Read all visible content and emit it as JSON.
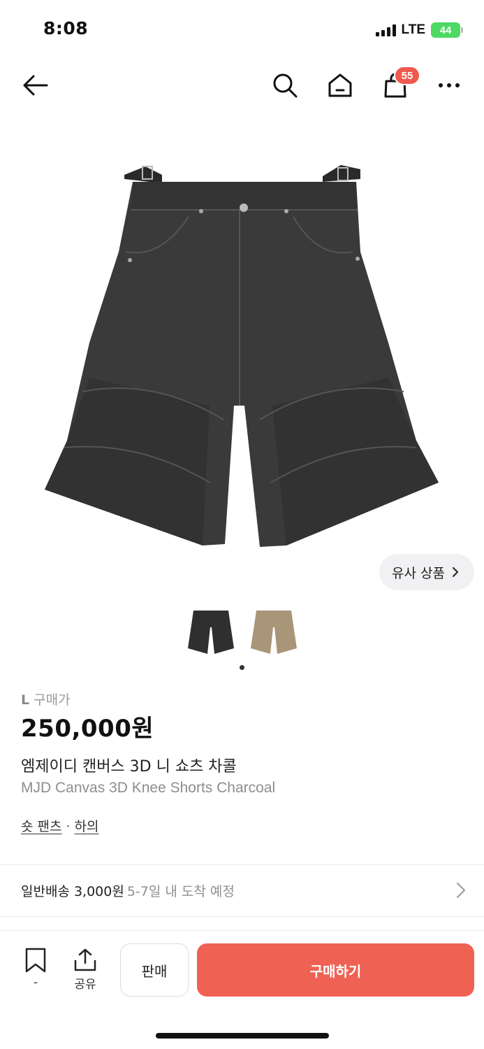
{
  "status": {
    "time": "8:08",
    "network": "LTE",
    "battery": "44"
  },
  "nav": {
    "cart_count": "55"
  },
  "similar": {
    "label": "유사 상품"
  },
  "product": {
    "price_size": "L",
    "price_label": "구매가",
    "price": "250,000원",
    "name_ko": "엠제이디 캔버스 3D 니 쇼츠 차콜",
    "name_en": "MJD Canvas 3D Knee Shorts Charcoal",
    "category_1": "숏 팬츠",
    "category_sep": "·",
    "category_2": "하의"
  },
  "shipping": {
    "label": "일반배송 3,000원",
    "eta": "5-7일 내 도착 예정"
  },
  "bottom": {
    "bookmark_count": "-",
    "share_label": "공유",
    "sell_label": "판매",
    "buy_label": "구매하기"
  },
  "colors": {
    "accent": "#ef6253",
    "badge": "#ef5a4f",
    "battery": "#4cd964"
  }
}
